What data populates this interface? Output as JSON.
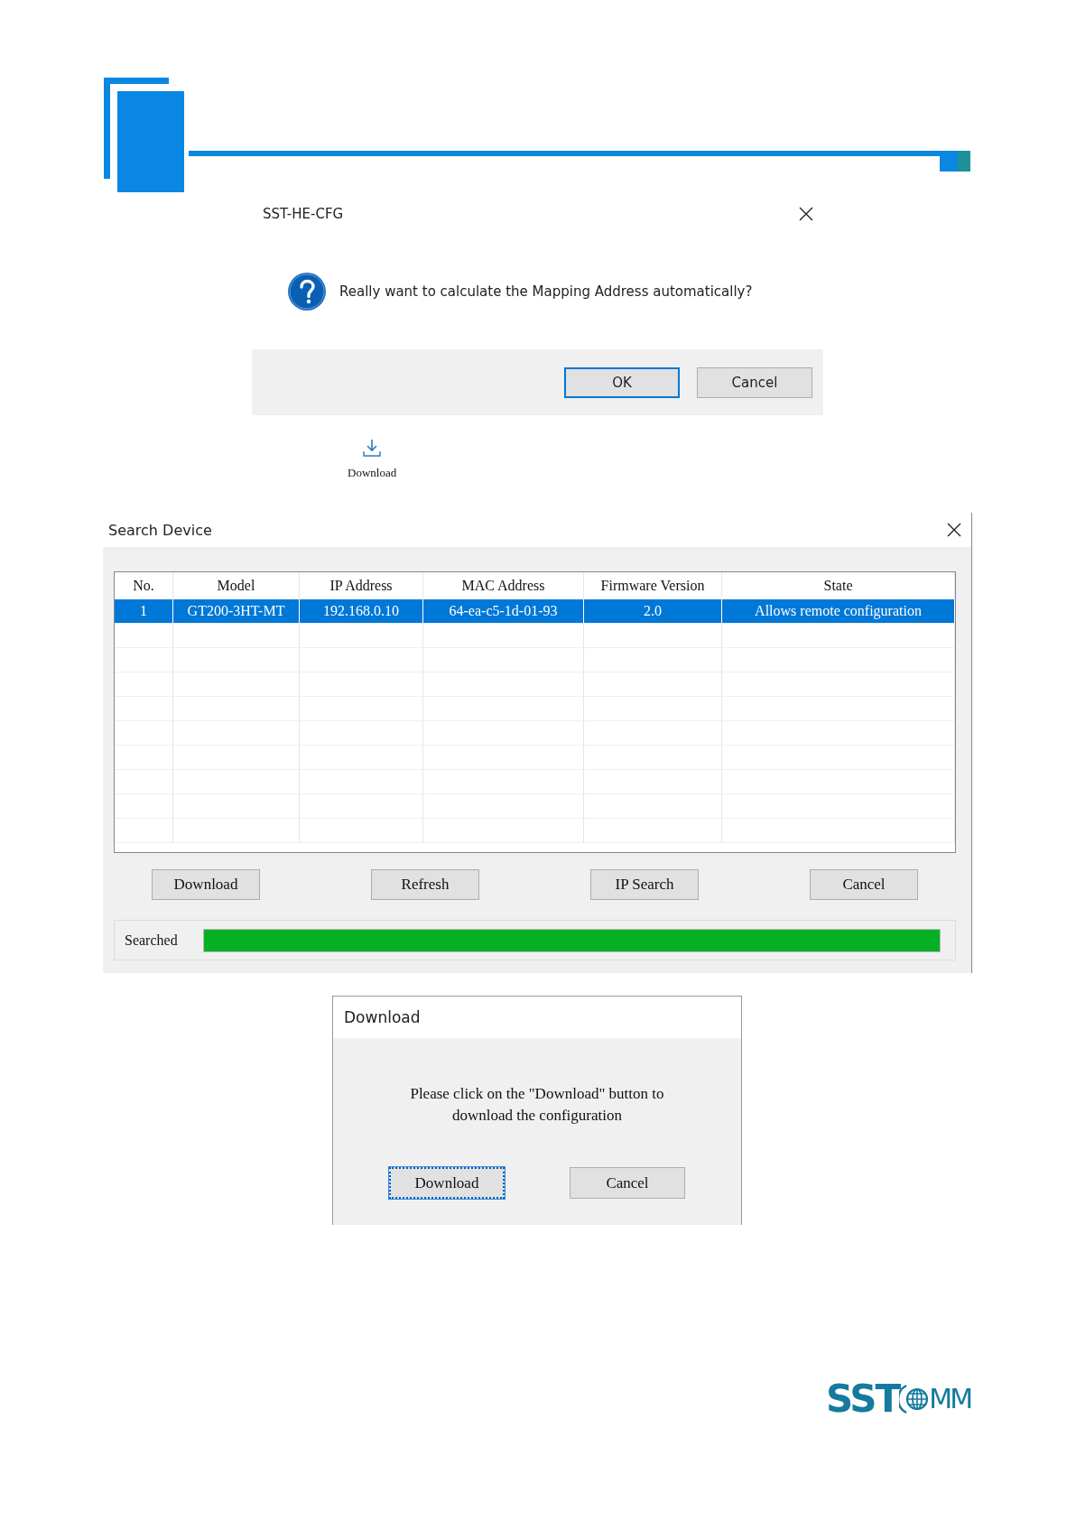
{
  "confirm_dialog": {
    "title": "SST-HE-CFG",
    "message": "Really want to calculate the Mapping Address automatically?",
    "buttons": [
      {
        "label": "OK",
        "focused": true
      },
      {
        "label": "Cancel",
        "focused": false
      }
    ]
  },
  "toolbar_button": {
    "label": "Download"
  },
  "search_dialog": {
    "title": "Search Device",
    "table": {
      "columns": [
        "No.",
        "Model",
        "IP Address",
        "MAC Address",
        "Firmware Version",
        "State"
      ],
      "rows": [
        {
          "cells": [
            "1",
            "GT200-3HT-MT",
            "192.168.0.10",
            "64-ea-c5-1d-01-93",
            "2.0",
            "Allows remote configuration"
          ],
          "selected": true
        }
      ]
    },
    "buttons": [
      "Download",
      "Refresh",
      "IP Search",
      "Cancel"
    ],
    "progress": {
      "label": "Searched",
      "level": 1
    }
  },
  "download_dialog": {
    "title": "Download",
    "message": "Please click on the \"Download\" button to download the configuration",
    "buttons": [
      {
        "label": "Download",
        "focused": true
      },
      {
        "label": "Cancel",
        "focused": false
      }
    ]
  },
  "logo": {
    "text_left": "SST",
    "text_right": "MM"
  }
}
